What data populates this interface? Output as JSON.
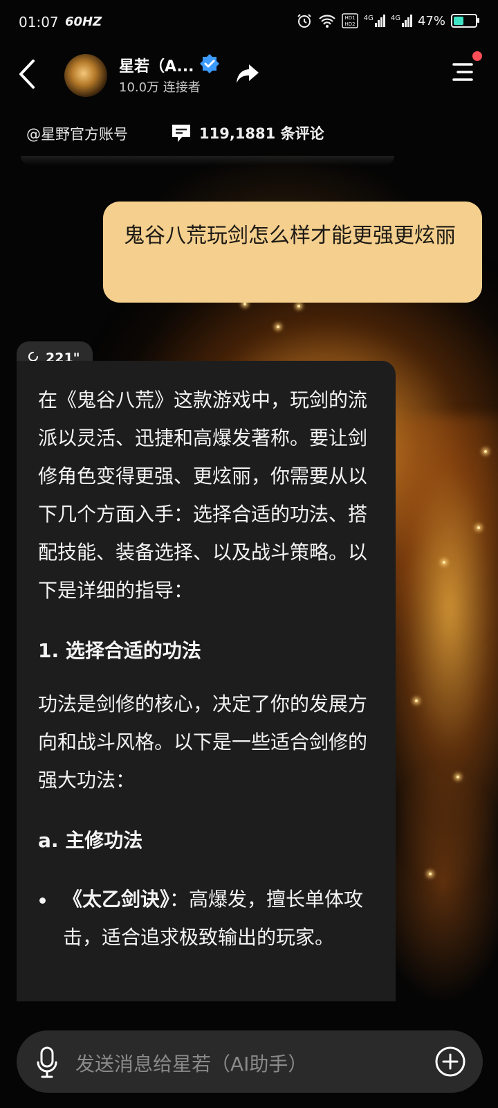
{
  "status_bar": {
    "time": "01:07",
    "refresh_rate": "60HZ",
    "network_1": "4G",
    "network_2": "4G",
    "battery_percent": "47%",
    "battery_level": 0.47
  },
  "header": {
    "name": "星若（A...",
    "connectors": "10.0万 连接者"
  },
  "info": {
    "account": "@星野官方账号",
    "comments": "119,1881 条评论"
  },
  "user_message": "鬼谷八荒玩剑怎么样才能更强更炫丽",
  "ai_message": {
    "duration": "221\"",
    "intro": "在《鬼谷八荒》这款游戏中，玩剑的流派以灵活、迅捷和高爆发著称。要让剑修角色变得更强、更炫丽，你需要从以下几个方面入手：选择合适的功法、搭配技能、装备选择、以及战斗策略。以下是详细的指导：",
    "section1_title": "1. 选择合适的功法",
    "section1_text": "功法是剑修的核心，决定了你的发展方向和战斗风格。以下是一些适合剑修的强大功法：",
    "subsection_a": "a. 主修功法",
    "bullet1_name": "《太乙剑诀》",
    "bullet1_text": "：高爆发，擅长单体攻击，适合追求极致输出的玩家。"
  },
  "input": {
    "placeholder": "发送消息给星若（AI助手）"
  },
  "colors": {
    "user_bubble": "#f4cf8e",
    "ai_bubble": "#1d1d1d",
    "badge": "#ff4d57",
    "verify": "#3d9bff"
  }
}
